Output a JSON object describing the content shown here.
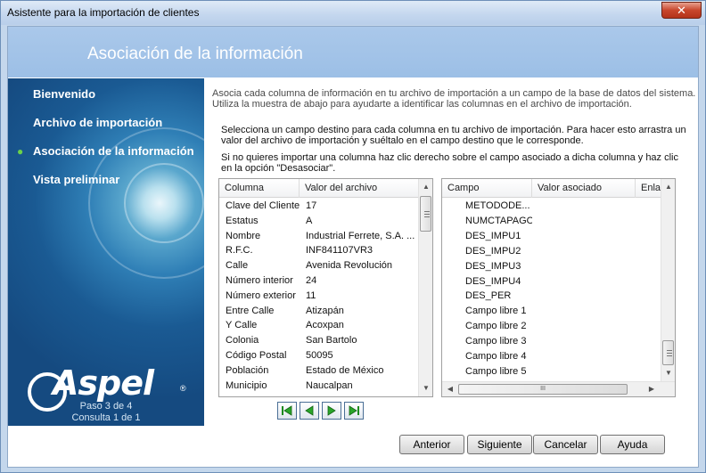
{
  "window": {
    "title": "Asistente para la importación de clientes",
    "close_glyph": "✕"
  },
  "header": {
    "title": "Asociación de la información"
  },
  "sidebar": {
    "steps": [
      {
        "label": "Bienvenido",
        "active": false
      },
      {
        "label": "Archivo de importación",
        "active": false
      },
      {
        "label": "Asociación de la información",
        "active": true
      },
      {
        "label": "Vista preliminar",
        "active": false
      }
    ],
    "logo_text": "Aspel",
    "logo_reg": "®",
    "page_step": "Paso 3 de 4",
    "page_query": "Consulta 1 de 1"
  },
  "main": {
    "intro_line1": "Asocia cada columna de información en tu archivo de importación a un campo de la base de datos del sistema.",
    "intro_line2": "Utiliza la muestra de abajo para ayudarte a identificar las columnas en el archivo de importación.",
    "instr_line1": "Selecciona un campo destino para cada columna en tu archivo de importación. Para hacer esto arrastra un",
    "instr_line2": "valor del archivo de importación y suéltalo en el campo destino que le corresponde.",
    "instr2_line1": "Si no quieres importar una columna haz clic derecho sobre el campo asociado a dicha columna y haz clic",
    "instr2_line2": "en la opción \"Desasociar\"."
  },
  "source_grid": {
    "headers": [
      "Columna",
      "Valor del archivo"
    ],
    "rows": [
      [
        "Clave del Cliente",
        "17"
      ],
      [
        "Estatus",
        "A"
      ],
      [
        "Nombre",
        "Industrial Ferrete, S.A. ..."
      ],
      [
        "R.F.C.",
        "INF841107VR3"
      ],
      [
        "Calle",
        "Avenida Revolución"
      ],
      [
        "Número interior",
        "24"
      ],
      [
        "Número exterior",
        "11"
      ],
      [
        "Entre Calle",
        " Atizapán"
      ],
      [
        "Y Calle",
        " Acoxpan"
      ],
      [
        "Colonia",
        "San Bartolo"
      ],
      [
        "Código Postal",
        "50095"
      ],
      [
        "Población",
        "Estado de México"
      ],
      [
        "Municipio",
        "Naucalpan"
      ]
    ]
  },
  "dest_grid": {
    "headers": [
      "Campo",
      "Valor asociado",
      "Enla"
    ],
    "rows": [
      "METODODE...",
      "NUMCTAPAGO",
      "DES_IMPU1",
      "DES_IMPU2",
      "DES_IMPU3",
      "DES_IMPU4",
      "DES_PER",
      "Campo libre 1",
      "Campo libre 2",
      "Campo libre 3",
      "Campo libre 4",
      "Campo libre 5"
    ],
    "scroll_grip": "III"
  },
  "nav_icons": [
    "first-record-icon",
    "prev-record-icon",
    "next-record-icon",
    "last-record-icon"
  ],
  "buttons": {
    "back": "Anterior",
    "next": "Siguiente",
    "cancel": "Cancelar",
    "help": "Ayuda"
  },
  "colors": {
    "header_band": "#a6c6ea",
    "sidebar": "#1f5f98",
    "active_bullet": "#6bd14a",
    "nav_border": "#4b6f96"
  }
}
